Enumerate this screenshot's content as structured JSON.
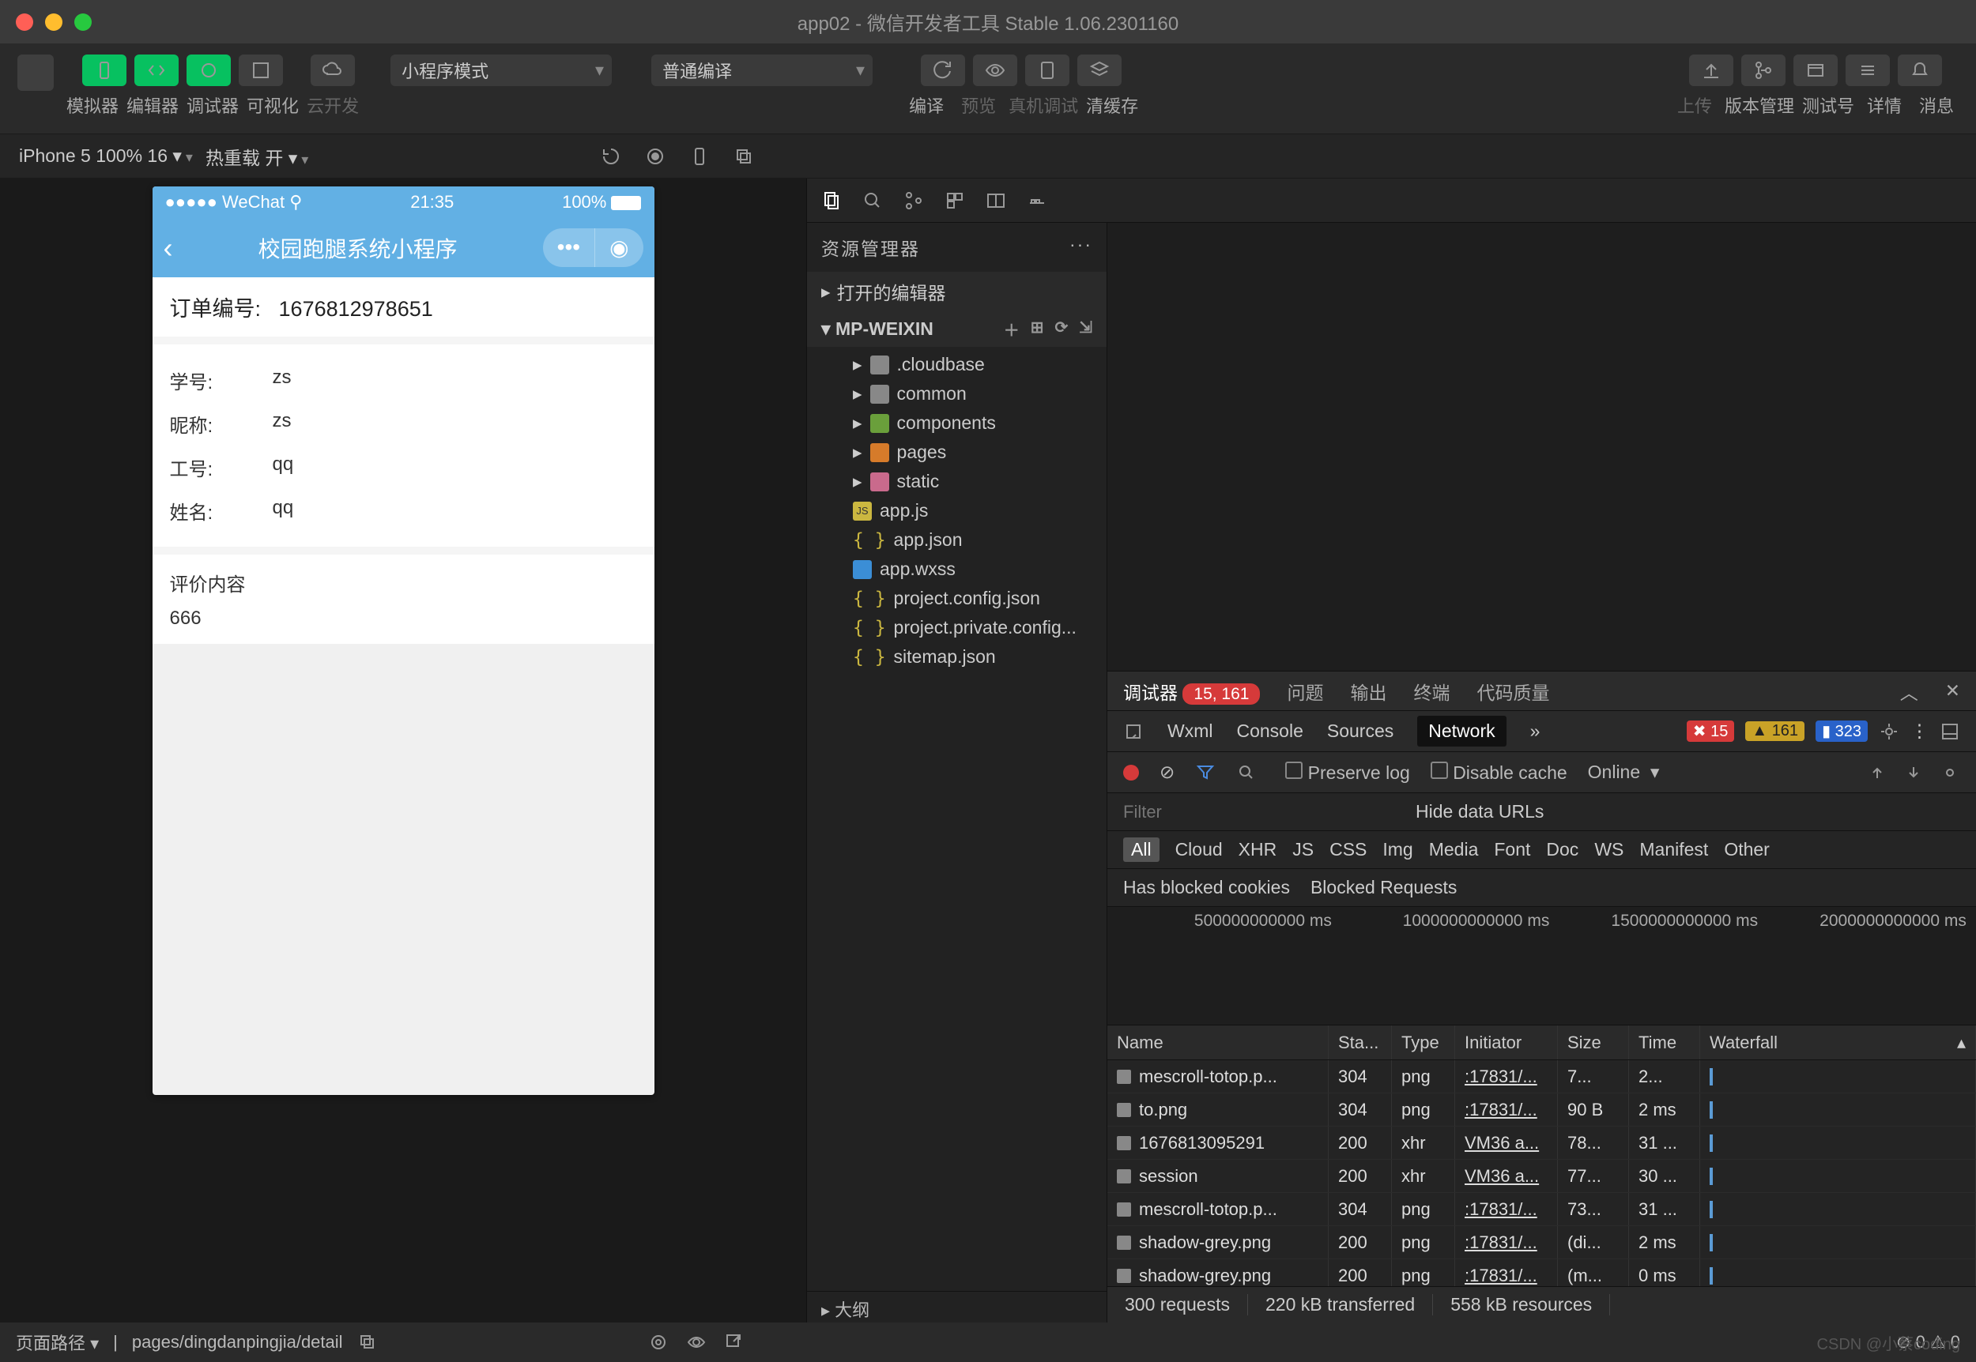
{
  "window": {
    "title": "app02 - 微信开发者工具 Stable 1.06.2301160"
  },
  "toolbar": {
    "modeLabels": [
      "模拟器",
      "编辑器",
      "调试器",
      "可视化"
    ],
    "cloud": "云开发",
    "miniMode": "小程序模式",
    "compileMode": "普通编译",
    "actions": [
      "编译",
      "预览",
      "真机调试",
      "清缓存"
    ],
    "rightActions": [
      "上传",
      "版本管理",
      "测试号",
      "详情",
      "消息"
    ]
  },
  "subbar": {
    "device": "iPhone 5 100% 16 ▾",
    "hotreload": "热重载 开 ▾"
  },
  "simulator": {
    "statusLeft": "●●●●● WeChat",
    "wifiIcon": "wifi",
    "time": "21:35",
    "battery": "100%",
    "headerTitle": "校园跑腿系统小程序",
    "order": {
      "label": "订单编号:",
      "value": "1676812978651"
    },
    "fields": [
      {
        "label": "学号:",
        "value": "zs"
      },
      {
        "label": "昵称:",
        "value": "zs"
      },
      {
        "label": "工号:",
        "value": "qq"
      },
      {
        "label": "姓名:",
        "value": "qq"
      }
    ],
    "commentTitle": "评价内容",
    "commentBody": "666"
  },
  "explorer": {
    "title": "资源管理器",
    "openEditors": "打开的编辑器",
    "project": "MP-WEIXIN",
    "tree": [
      {
        "type": "folder",
        "cls": "g",
        "name": ".cloudbase"
      },
      {
        "type": "folder",
        "cls": "g",
        "name": "common"
      },
      {
        "type": "folder",
        "cls": "gr",
        "name": "components"
      },
      {
        "type": "folder",
        "cls": "or",
        "name": "pages"
      },
      {
        "type": "folder",
        "cls": "pk",
        "name": "static"
      },
      {
        "type": "file",
        "icon": "js",
        "name": "app.js"
      },
      {
        "type": "file",
        "icon": "json",
        "name": "app.json"
      },
      {
        "type": "file",
        "icon": "wxss",
        "name": "app.wxss"
      },
      {
        "type": "file",
        "icon": "json",
        "name": "project.config.json"
      },
      {
        "type": "file",
        "icon": "json",
        "name": "project.private.config..."
      },
      {
        "type": "file",
        "icon": "json",
        "name": "sitemap.json"
      }
    ],
    "outline": "大纲"
  },
  "devtools": {
    "tabs": [
      "调试器",
      "问题",
      "输出",
      "终端",
      "代码质量"
    ],
    "badge": "15, 161",
    "subtabs": [
      "Wxml",
      "Console",
      "Sources",
      "Network"
    ],
    "counts": {
      "err": "15",
      "warn": "161",
      "info": "323"
    },
    "preserve": "Preserve log",
    "disableCache": "Disable cache",
    "online": "Online",
    "filterPlaceholder": "Filter",
    "hideData": "Hide data URLs",
    "types": [
      "All",
      "Cloud",
      "XHR",
      "JS",
      "CSS",
      "Img",
      "Media",
      "Font",
      "Doc",
      "WS",
      "Manifest",
      "Other"
    ],
    "blocked1": "Has blocked cookies",
    "blocked2": "Blocked Requests",
    "ticks": [
      "500000000000 ms",
      "1000000000000 ms",
      "1500000000000 ms",
      "2000000000000 ms"
    ],
    "columns": [
      "Name",
      "Sta...",
      "Type",
      "Initiator",
      "Size",
      "Time",
      "Waterfall"
    ],
    "rows": [
      {
        "name": "mescroll-totop.p...",
        "status": "304",
        "type": "png",
        "init": ":17831/...",
        "size": "7...",
        "time": "2..."
      },
      {
        "name": "to.png",
        "status": "304",
        "type": "png",
        "init": ":17831/...",
        "size": "90 B",
        "time": "2 ms"
      },
      {
        "name": "1676813095291",
        "status": "200",
        "type": "xhr",
        "init": "VM36 a...",
        "size": "78...",
        "time": "31 ..."
      },
      {
        "name": "session",
        "status": "200",
        "type": "xhr",
        "init": "VM36 a...",
        "size": "77...",
        "time": "30 ..."
      },
      {
        "name": "mescroll-totop.p...",
        "status": "304",
        "type": "png",
        "init": ":17831/...",
        "size": "73...",
        "time": "31 ..."
      },
      {
        "name": "shadow-grey.png",
        "status": "200",
        "type": "png",
        "init": ":17831/...",
        "size": "(di...",
        "time": "2 ms"
      },
      {
        "name": "shadow-grey.png",
        "status": "200",
        "type": "png",
        "init": ":17831/...",
        "size": "(m...",
        "time": "0 ms"
      }
    ],
    "status": [
      "300 requests",
      "220 kB transferred",
      "558 kB resources"
    ]
  },
  "footer": {
    "pathLabel": "页面路径 ▾",
    "path": "pages/dingdanpingjia/detail",
    "diag": "⊘ 0 ⚠ 0"
  },
  "watermark": "CSDN @小蔡coding"
}
